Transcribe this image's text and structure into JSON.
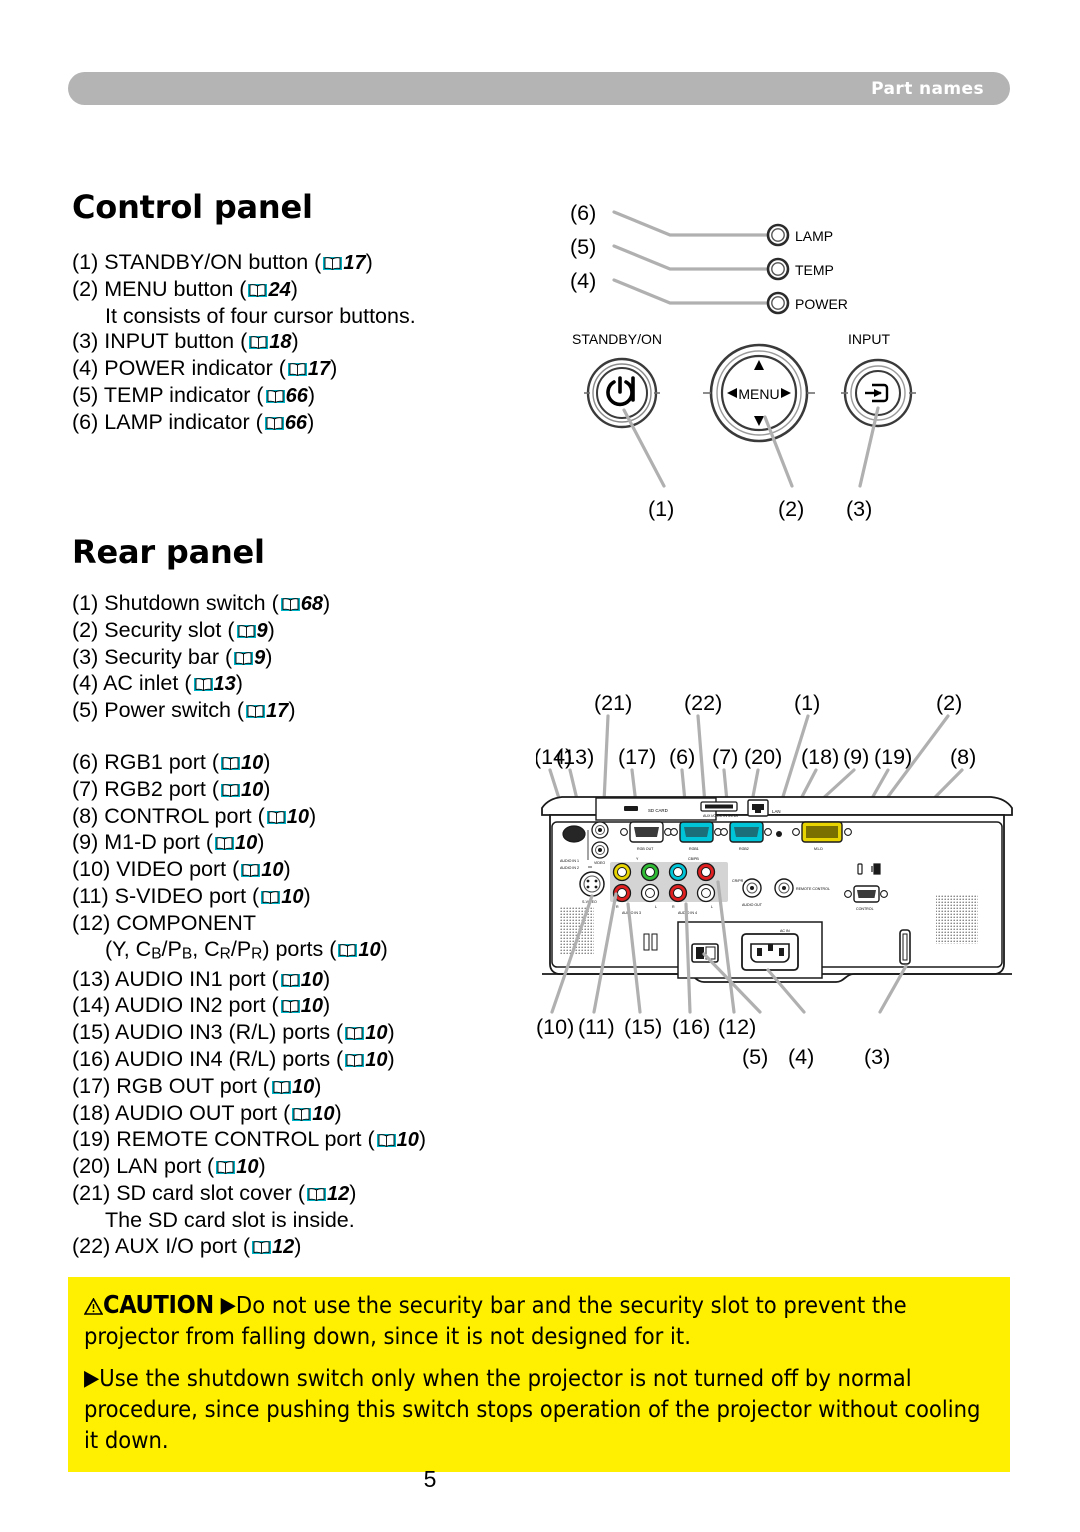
{
  "header": {
    "title": "Part names"
  },
  "control_panel": {
    "title": "Control panel",
    "items": [
      {
        "num": "(1)",
        "text": "STANDBY/ON button",
        "page": "17"
      },
      {
        "num": "(2)",
        "text": "MENU button",
        "page": "24"
      },
      {
        "num": "",
        "text": "It consists of four cursor buttons.",
        "page": ""
      },
      {
        "num": "(3)",
        "text": "INPUT button",
        "page": "18"
      },
      {
        "num": "(4)",
        "text": "POWER indicator",
        "page": "17"
      },
      {
        "num": "(5)",
        "text": "TEMP indicator",
        "page": "66"
      },
      {
        "num": "(6)",
        "text": "LAMP indicator",
        "page": "66"
      }
    ],
    "figure": {
      "indicator_labels": [
        "LAMP",
        "TEMP",
        "POWER"
      ],
      "indicator_callouts": [
        "(6)",
        "(5)",
        "(4)"
      ],
      "button_labels": [
        "STANDBY/ON",
        "INPUT"
      ],
      "menu_label": "MENU",
      "button_callouts": [
        "(1)",
        "(2)",
        "(3)"
      ]
    }
  },
  "rear_panel": {
    "title": "Rear panel",
    "items": [
      {
        "num": "(1)",
        "text": "Shutdown switch",
        "page": "68"
      },
      {
        "num": "(2)",
        "text": "Security slot",
        "page": "9"
      },
      {
        "num": "(3)",
        "text": "Security bar",
        "page": "9"
      },
      {
        "num": "(4)",
        "text": "AC inlet",
        "page": "13"
      },
      {
        "num": "(5)",
        "text": "Power switch",
        "page": "17"
      },
      {
        "num": "(6)",
        "text": "RGB1 port",
        "page": "10"
      },
      {
        "num": "(7)",
        "text": "RGB2 port",
        "page": "10"
      },
      {
        "num": "(8)",
        "text": "CONTROL port",
        "page": "10"
      },
      {
        "num": "(9)",
        "text": "M1-D port",
        "page": "10"
      },
      {
        "num": "(10)",
        "text": "VIDEO port",
        "page": "10"
      },
      {
        "num": "(11)",
        "text": "S-VIDEO port",
        "page": "10"
      },
      {
        "num": "(12)",
        "text": "COMPONENT",
        "page": ""
      },
      {
        "num": "",
        "text": "(Y, CB/PB, CR/PR) ports",
        "page": "10"
      },
      {
        "num": "(13)",
        "text": "AUDIO IN1 port",
        "page": "10"
      },
      {
        "num": "(14)",
        "text": "AUDIO IN2 port",
        "page": "10"
      },
      {
        "num": "(15)",
        "text": "AUDIO IN3 (R/L) ports",
        "page": "10"
      },
      {
        "num": "(16)",
        "text": "AUDIO IN4 (R/L) ports",
        "page": "10"
      },
      {
        "num": "(17)",
        "text": "RGB OUT port",
        "page": "10"
      },
      {
        "num": "(18)",
        "text": "AUDIO OUT port",
        "page": "10"
      },
      {
        "num": "(19)",
        "text": "REMOTE CONTROL port",
        "page": "10"
      },
      {
        "num": "(20)",
        "text": "LAN port",
        "page": "10"
      },
      {
        "num": "(21)",
        "text": "SD card slot cover",
        "page": "12"
      },
      {
        "num": "",
        "text": "The SD card slot is inside.",
        "page": ""
      },
      {
        "num": "(22)",
        "text": "AUX I/O port",
        "page": "12"
      }
    ],
    "figure": {
      "callouts_row_top": [
        "(21)",
        "(22)",
        "(1)",
        "(2)"
      ],
      "callouts_row_second": [
        "(14)",
        "(13)",
        "(17)",
        "(6)",
        "(7)",
        "(20)",
        "(18)",
        "(9)",
        "(19)",
        "(8)"
      ],
      "callouts_row_bottom": [
        "(10)",
        "(11)",
        "(15)",
        "(16)",
        "(12)"
      ],
      "callouts_row_last": [
        "(5)",
        "(4)",
        "(3)"
      ],
      "port_labels": [
        "SD CARD",
        "AUX I/O DC IN 5V/1A",
        "LAN",
        "RGB OUT",
        "RGB1",
        "RGB2",
        "M1-D",
        "AUDIO IN 1",
        "AUDIO IN 2",
        "VIDEO",
        "S-VIDEO",
        "AUDIO IN 3",
        "AUDIO IN 4",
        "R",
        "L",
        "Y",
        "CB/PB",
        "CR/PR",
        "AUDIO OUT",
        "REMOTE CONTROL",
        "CONTROL",
        "AC IN"
      ]
    }
  },
  "caution": {
    "heading": "CAUTION",
    "paragraphs": [
      "Do not use the security bar and the security slot to prevent the projector from falling down, since it is not designed for it.",
      "Use the shutdown switch only when the projector is not turned off by normal procedure, since pushing this switch stops operation of the projector without cooling it down."
    ],
    "background_color": "#ffef00",
    "arrow": "▶"
  },
  "page_number": "5",
  "colors": {
    "header_bar": "#b4b4b4",
    "book_icon": "#00b5c8",
    "caution_bg": "#ffef00",
    "leader_line": "#b0b0b0"
  }
}
